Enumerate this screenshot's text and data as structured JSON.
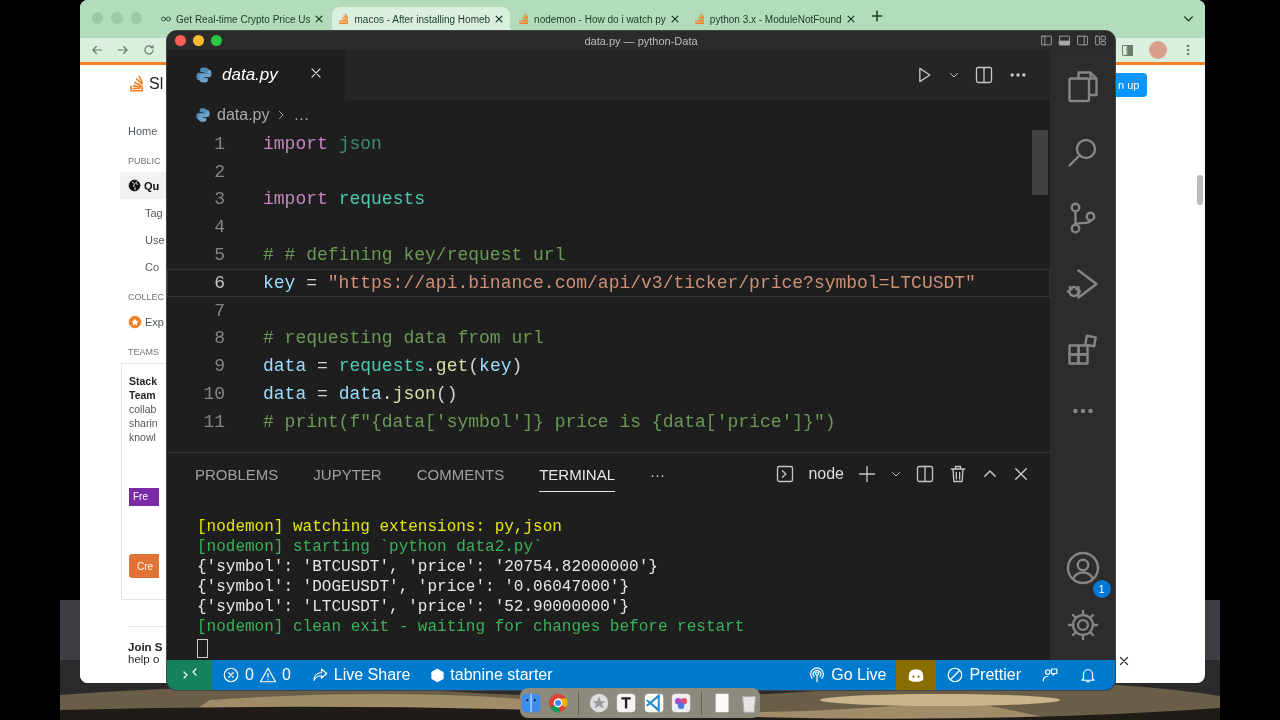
{
  "browser": {
    "tabs": [
      {
        "title": "Get Real-time Crypto Price Us",
        "selected": false
      },
      {
        "title": "macos - After installing Homeb",
        "selected": true
      },
      {
        "title": "nodemon - How do i watch py",
        "selected": false
      },
      {
        "title": "python 3.x - ModuleNotFound",
        "selected": false
      }
    ],
    "page": {
      "logo_text": "Sl",
      "signup_button": "n up",
      "sidebar": [
        {
          "kind": "link",
          "label": "Home",
          "selected": false
        },
        {
          "kind": "heading",
          "label": "PUBLIC"
        },
        {
          "kind": "link",
          "label": "Qu",
          "selected": true
        },
        {
          "kind": "sub",
          "label": "Tag",
          "selected": false
        },
        {
          "kind": "sub",
          "label": "Use",
          "selected": false
        },
        {
          "kind": "sub",
          "label": "Co",
          "selected": false
        },
        {
          "kind": "heading",
          "label": "COLLEC"
        },
        {
          "kind": "collective",
          "label": "Exp",
          "selected": false
        },
        {
          "kind": "heading",
          "label": "TEAMS"
        }
      ],
      "teams_card": {
        "title_lines": [
          "Stack",
          "Team"
        ],
        "text_lines": [
          "collab",
          "sharin",
          "knowl"
        ],
        "badge": "Fre",
        "button": "Cre"
      },
      "banner": {
        "title": "Join S",
        "text": "help o"
      }
    }
  },
  "editor": {
    "window_title": "data.py — python-Data",
    "tab": {
      "label": "data.py"
    },
    "breadcrumb": [
      "data.py",
      "…"
    ],
    "lines": [
      {
        "number": "1",
        "current": false,
        "tokens": [
          {
            "kind": "keyword",
            "text": "import "
          },
          {
            "kind": "module_dim",
            "text": "json"
          }
        ]
      },
      {
        "number": "2",
        "current": false
      },
      {
        "number": "3",
        "current": false,
        "tokens": [
          {
            "kind": "keyword",
            "text": "import "
          },
          {
            "kind": "module",
            "text": "requests"
          }
        ]
      },
      {
        "number": "4",
        "current": false
      },
      {
        "number": "5",
        "current": false,
        "tokens": [
          {
            "kind": "comment",
            "text": "# # defining key/request url"
          }
        ]
      },
      {
        "number": "6",
        "current": true,
        "tokens": [
          {
            "kind": "variable",
            "text": "key"
          },
          {
            "kind": "plain",
            "text": " = "
          },
          {
            "kind": "string",
            "text": "\"https://api.binance.com/api/v3/ticker/price?symbol=LTCUSDT\""
          }
        ]
      },
      {
        "number": "7",
        "current": false
      },
      {
        "number": "8",
        "current": false,
        "tokens": [
          {
            "kind": "comment",
            "text": "# requesting data from url"
          }
        ]
      },
      {
        "number": "9",
        "current": false,
        "tokens": [
          {
            "kind": "variable",
            "text": "data"
          },
          {
            "kind": "plain",
            "text": " = "
          },
          {
            "kind": "module",
            "text": "requests"
          },
          {
            "kind": "plain",
            "text": "."
          },
          {
            "kind": "func",
            "text": "get"
          },
          {
            "kind": "plain",
            "text": "("
          },
          {
            "kind": "variable",
            "text": "key"
          },
          {
            "kind": "plain",
            "text": ")"
          }
        ]
      },
      {
        "number": "10",
        "current": false,
        "tokens": [
          {
            "kind": "variable",
            "text": "data"
          },
          {
            "kind": "plain",
            "text": " = "
          },
          {
            "kind": "variable",
            "text": "data"
          },
          {
            "kind": "plain",
            "text": "."
          },
          {
            "kind": "func",
            "text": "json"
          },
          {
            "kind": "plain",
            "text": "()"
          }
        ]
      },
      {
        "number": "11",
        "current": false,
        "tokens": [
          {
            "kind": "comment",
            "text": "# print(f\"{data['symbol']} price is {data['price']}\")"
          }
        ]
      }
    ],
    "panel": {
      "tabs": [
        {
          "label": "PROBLEMS",
          "selected": false
        },
        {
          "label": "JUPYTER",
          "selected": false
        },
        {
          "label": "COMMENTS",
          "selected": false
        },
        {
          "label": "TERMINAL",
          "selected": true
        }
      ],
      "more": "···",
      "shell": "node",
      "terminal": [
        {
          "kind": "notice",
          "text": "[nodemon] watching extensions: py,json"
        },
        {
          "kind": "status",
          "text": "[nodemon] starting `python data2.py`"
        },
        {
          "kind": "output",
          "text": "{'symbol': 'BTCUSDT', 'price': '20754.82000000'}"
        },
        {
          "kind": "output",
          "text": "{'symbol': 'DOGEUSDT', 'price': '0.06047000'}"
        },
        {
          "kind": "output",
          "text": "{'symbol': 'LTCUSDT', 'price': '52.90000000'}"
        },
        {
          "kind": "status",
          "text": "[nodemon] clean exit - waiting for changes before restart"
        }
      ]
    },
    "account_badge": "1",
    "status_bar": {
      "errors": "0",
      "warnings": "0",
      "live_share": "Live Share",
      "tabnine": "tabnine starter",
      "go_live": "Go Live",
      "prettier": "Prettier"
    }
  }
}
